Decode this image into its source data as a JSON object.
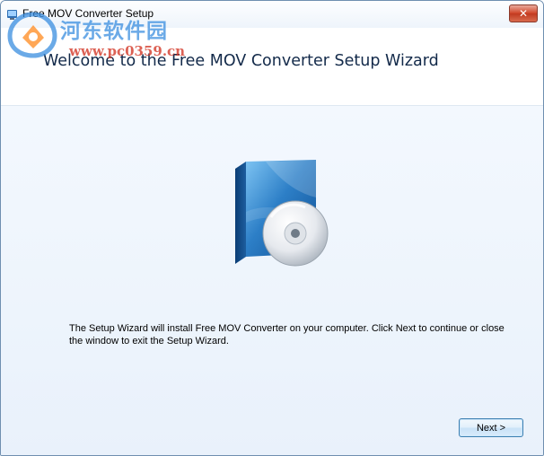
{
  "window": {
    "title": "Free MOV Converter Setup",
    "close_label": "✕"
  },
  "watermark": {
    "line1": "河东软件园",
    "line2": "www.pc0359.cn"
  },
  "header": {
    "title": "Welcome to the Free MOV Converter Setup Wizard"
  },
  "main": {
    "description": "The Setup Wizard will install Free MOV Converter on your computer. Click Next to continue or close the window to exit the Setup Wizard."
  },
  "buttons": {
    "next_label": "Next >"
  },
  "colors": {
    "accent": "#3c7fb1",
    "header_title": "#132a4a",
    "close": "#c13a20"
  }
}
